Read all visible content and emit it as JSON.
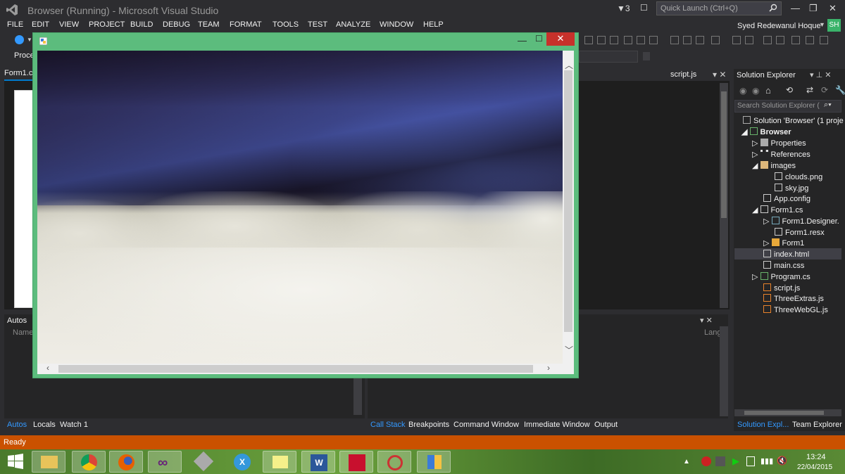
{
  "window": {
    "title": "Browser (Running) - Microsoft Visual Studio",
    "notification_count": "3",
    "quick_launch_placeholder": "Quick Launch (Ctrl+Q)",
    "user_name": "Syed Redewanul Hoque",
    "user_initials": "SH"
  },
  "menu": [
    "FILE",
    "EDIT",
    "VIEW",
    "PROJECT",
    "BUILD",
    "DEBUG",
    "TEAM",
    "FORMAT",
    "TOOLS",
    "TEST",
    "ANALYZE",
    "WINDOW",
    "HELP"
  ],
  "toolbar": {
    "process_label": "Proce"
  },
  "doc_tabs": {
    "left": "Form1.c",
    "right": "script.js"
  },
  "autos": {
    "title": "Autos",
    "column_name": "Name",
    "column_lang": "Lang"
  },
  "bottom_tabs_left": [
    "Autos",
    "Locals",
    "Watch 1"
  ],
  "bottom_tabs_right": [
    "Call Stack",
    "Breakpoints",
    "Command Window",
    "Immediate Window",
    "Output"
  ],
  "solution_explorer": {
    "title": "Solution Explorer",
    "search_placeholder": "Search Solution Explorer (",
    "items": [
      {
        "label": "Solution 'Browser' (1 proje",
        "depth": 0
      },
      {
        "label": "Browser",
        "depth": 1
      },
      {
        "label": "Properties",
        "depth": 2
      },
      {
        "label": "References",
        "depth": 2
      },
      {
        "label": "images",
        "depth": 2
      },
      {
        "label": "clouds.png",
        "depth": 3
      },
      {
        "label": "sky.jpg",
        "depth": 3
      },
      {
        "label": "App.config",
        "depth": 2
      },
      {
        "label": "Form1.cs",
        "depth": 2
      },
      {
        "label": "Form1.Designer.",
        "depth": 3
      },
      {
        "label": "Form1.resx",
        "depth": 3
      },
      {
        "label": "Form1",
        "depth": 3
      },
      {
        "label": "index.html",
        "depth": 2
      },
      {
        "label": "main.css",
        "depth": 2
      },
      {
        "label": "Program.cs",
        "depth": 2
      },
      {
        "label": "script.js",
        "depth": 2
      },
      {
        "label": "ThreeExtras.js",
        "depth": 2
      },
      {
        "label": "ThreeWebGL.js",
        "depth": 2
      }
    ],
    "tab_solution": "Solution Expl...",
    "tab_team": "Team Explorer"
  },
  "status": {
    "text": "Ready",
    "color": "#ca5100"
  },
  "clock": {
    "time": "13:24",
    "date": "22/04/2015"
  },
  "taskbar_apps": [
    "file-explorer",
    "chrome",
    "firefox",
    "visual-studio",
    "tools",
    "xamarin",
    "sticky-notes",
    "word",
    "acrobat",
    "snipping",
    "running-app"
  ],
  "colors": {
    "accent": "#3399ff",
    "app_frame": "#5cbc7d",
    "close": "#c7312b"
  }
}
